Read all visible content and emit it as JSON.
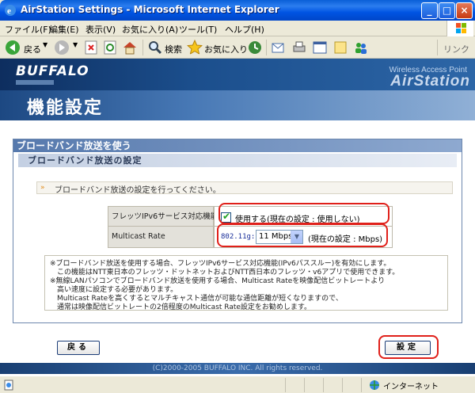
{
  "window": {
    "title": "AirStation Settings - Microsoft Internet Explorer"
  },
  "menu": [
    "ファイル(F)",
    "編集(E)",
    "表示(V)",
    "お気に入り(A)",
    "ツール(T)",
    "ヘルプ(H)"
  ],
  "toolbar": {
    "back_label": "戻る",
    "search_label": "検索",
    "favorites_label": "お気に入り",
    "links_label": "リンク"
  },
  "header": {
    "logo": "BUFFALO",
    "product_line": "Wireless Access Point",
    "product_name": "AirStation",
    "page_title": "機能設定"
  },
  "section": {
    "title": "ブロードバンド放送を使う",
    "subtitle": "ブロードバンド放送の設定",
    "info": "ブロードバンド放送の設定を行ってください。"
  },
  "form": {
    "ipv6": {
      "label": "フレッツIPv6サービス対応機能",
      "checkbox_label": "使用する(現在の設定 : 使用しない)",
      "checked": true
    },
    "multicast": {
      "label": "Multicast Rate",
      "prefix": "802.11g:",
      "selected": "11 Mbps",
      "note": "(現在の設定 : Mbps)"
    }
  },
  "notes": [
    "※ブロードバンド放送を使用する場合、フレッツIPv6サービス対応機能(IPv6パススルー)を有効にします。",
    "　この機能はNTT東日本のフレッツ・ドットネットおよびNTT西日本のフレッツ・v6アプリで使用できます。",
    "※無線LANパソコンでブロードバンド放送を使用する場合、Multicast Rateを映像配信ビットレートより",
    "　高い速度に設定する必要があります。",
    "　Multicast Rateを高くするとマルチキャスト通信が可能な通信距離が短くなりますので、",
    "　通常は映像配信ビットレートの2倍程度のMulticast Rate設定をお勧めします。"
  ],
  "buttons": {
    "back": "戻る",
    "submit": "設定"
  },
  "footer": "(C)2000-2005 BUFFALO INC. All rights reserved.",
  "status": {
    "zone": "インターネット"
  },
  "colors": {
    "titlebar": "#0054E3",
    "header": "#1B4E8C",
    "highlight": "#E0201A",
    "check": "#21A121"
  }
}
